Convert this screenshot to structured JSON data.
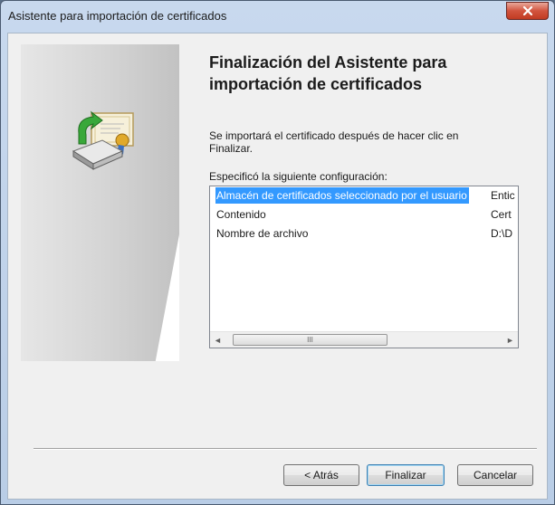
{
  "window": {
    "title": "Asistente para importación de certificados"
  },
  "wizard": {
    "heading": "Finalización del Asistente para importación de certificados",
    "description": "Se importará el certificado después de hacer clic en Finalizar.",
    "config_label": "Especificó la siguiente configuración:",
    "rows": [
      {
        "name": "Almacén de certificados seleccionado por el usuario",
        "value": "Entic"
      },
      {
        "name": "Contenido",
        "value": "Cert"
      },
      {
        "name": "Nombre de archivo",
        "value": "D:\\D"
      }
    ],
    "scroll_grip": "III"
  },
  "buttons": {
    "back": "< Atrás",
    "finish": "Finalizar",
    "cancel": "Cancelar"
  },
  "icons": {
    "close": "close-icon",
    "wizard": "certificate-import-icon",
    "scroll_left": "scroll-left-icon",
    "scroll_right": "scroll-right-icon"
  },
  "colors": {
    "selection": "#3399ff",
    "close_button": "#c13b22",
    "default_button_border": "#3c7fb1"
  }
}
